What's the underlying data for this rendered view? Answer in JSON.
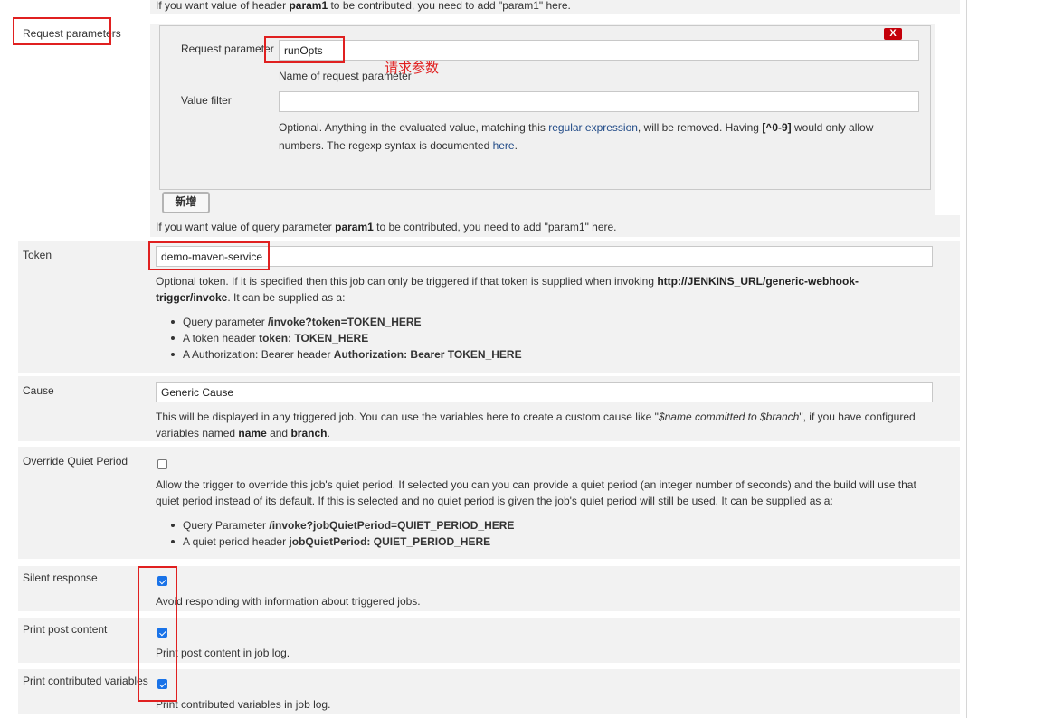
{
  "header_help": {
    "pre": "If you want value of header ",
    "bold": "param1",
    "post": " to be contributed, you need to add \"param1\" here."
  },
  "request_parameters": {
    "label": "Request parameters",
    "delete_label": "X",
    "param_label": "Request parameter",
    "param_value": "runOpts",
    "param_help": "Name of request parameter",
    "annotation": "请求参数",
    "filter_label": "Value filter",
    "filter_value": "",
    "filter_help": {
      "pre": "Optional. Anything in the evaluated value, matching this ",
      "link": "regular expression",
      "mid": ", will be removed. Having ",
      "bold": "[^0-9]",
      "post": " would only allow",
      "line2_pre": "numbers. The regexp syntax is documented ",
      "line2_link": "here",
      "line2_post": "."
    },
    "add_label": "新增",
    "help": {
      "pre": "If you want value of query parameter ",
      "bold": "param1",
      "post": " to be contributed, you need to add \"param1\" here."
    }
  },
  "token": {
    "label": "Token",
    "value": "demo-maven-service",
    "help_pre": "Optional token. If it is specified then this job can only be triggered if that token is supplied when invoking ",
    "help_bold1": "http://JENKINS_URL/generic-webhook-",
    "help_bold2": "trigger/invoke",
    "help_post": ". It can be supplied as a:",
    "items": [
      {
        "pre": "Query parameter ",
        "bold": "/invoke?token=TOKEN_HERE"
      },
      {
        "pre": "A token header ",
        "bold": "token: TOKEN_HERE"
      },
      {
        "pre": "A Authorization: Bearer header ",
        "bold": "Authorization: Bearer TOKEN_HERE"
      }
    ]
  },
  "cause": {
    "label": "Cause",
    "value": "Generic Cause",
    "help_pre": "This will be displayed in any triggered job. You can use the variables here to create a custom cause like \"",
    "help_italic": "$name committed to $branch",
    "help_mid": "\", if you have configured",
    "help_line2_pre": "variables named ",
    "help_bold1": "name",
    "help_and": " and ",
    "help_bold2": "branch",
    "help_end": "."
  },
  "quiet_period": {
    "label": "Override Quiet Period",
    "checked": false,
    "help_line1": "Allow the trigger to override this job's quiet period. If selected you can you can provide a quiet period (an integer number of seconds) and the build will use that",
    "help_line2": "quiet period instead of its default. If this is selected and no quiet period is given the job's quiet period will still be used. It can be supplied as a:",
    "items": [
      {
        "pre": "Query Parameter ",
        "bold": "/invoke?jobQuietPeriod=QUIET_PERIOD_HERE"
      },
      {
        "pre": "A quiet period header ",
        "bold": "jobQuietPeriod: QUIET_PERIOD_HERE"
      }
    ]
  },
  "silent_response": {
    "label": "Silent response",
    "checked": true,
    "help": "Avoid responding with information about triggered jobs."
  },
  "print_post": {
    "label": "Print post content",
    "checked": true,
    "help": "Print post content in job log."
  },
  "print_vars": {
    "label": "Print contributed variables",
    "checked": true,
    "help": "Print contributed variables in job log."
  },
  "colors": {
    "annotation_red": "#e02020",
    "delete_red": "#c4000a",
    "link": "#204a87",
    "checkbox_blue": "#1a73e8"
  }
}
